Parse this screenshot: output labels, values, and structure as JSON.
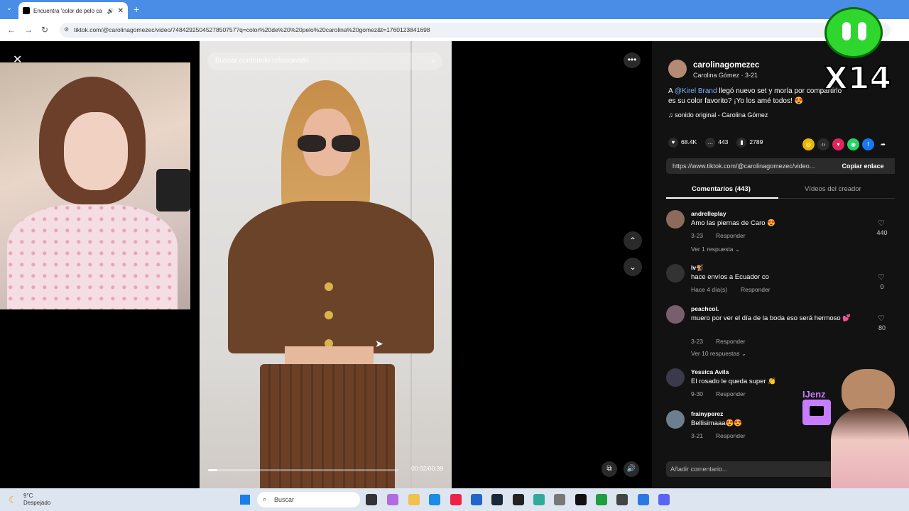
{
  "browser": {
    "tab_title": "Encuentra 'color de pelo ca",
    "tab_close": "✕",
    "new_tab": "+",
    "url": "tiktok.com/@carolinagomezec/video/7484292504527850757?q=color%20de%20%20pelo%20carolina%20gomez&t=1760123841698"
  },
  "player": {
    "search_placeholder": "Buscar contenido relacionado",
    "time": "00:02/00:39",
    "progress": 0.05
  },
  "post": {
    "username": "carolinagomezec",
    "display_sub": "Carolina Gómez · 3-21",
    "desc_prefix": "A ",
    "mention": "@Kirel Brand",
    "desc_rest": " llegó nuevo set y moría por compartirlo",
    "desc_line2": "es su color favorito? ¡Yo los amé todos! 😍",
    "sound": "sonido original - Carolina Gómez",
    "likes": "68.4K",
    "comments": "443",
    "saves": "2789",
    "link": "https://www.tiktok.com/@carolinagomezec/video...",
    "copy_label": "Copiar enlace",
    "tab_comments": "Comentarios (443)",
    "tab_creator": "Vídeos del creador",
    "add_comment": "Añadir comentario..."
  },
  "comments": [
    {
      "user": "andrelleplay",
      "text": "Amo las piernas de Caro 😍",
      "date": "3-23",
      "reply": "Responder",
      "likes": "440",
      "view": "Ver 1 respuesta ⌄"
    },
    {
      "user": "lv🐒",
      "text": "hace envíos a Ecuador co",
      "date": "Hace 4 día(s)",
      "reply": "Responder",
      "likes": "0",
      "view": ""
    },
    {
      "user": "peachcol.",
      "text": "muero por ver el día de la boda eso será hermoso 💕",
      "date": "3-23",
      "reply": "Responder",
      "likes": "80",
      "view": "Ver 10 respuestas ⌄"
    },
    {
      "user": "Yessica Avila",
      "text": "El rosado le queda super 👏",
      "date": "9-30",
      "reply": "Responder",
      "likes": "",
      "view": ""
    },
    {
      "user": "frainyperez",
      "text": "Bellisimaaa😍😍",
      "date": "3-21",
      "reply": "Responder",
      "likes": "",
      "view": ""
    }
  ],
  "overlay": {
    "x14": "X14",
    "streamer": "IJenz"
  },
  "taskbar": {
    "temp": "9°C",
    "weather": "Despejado",
    "search": "Buscar"
  }
}
